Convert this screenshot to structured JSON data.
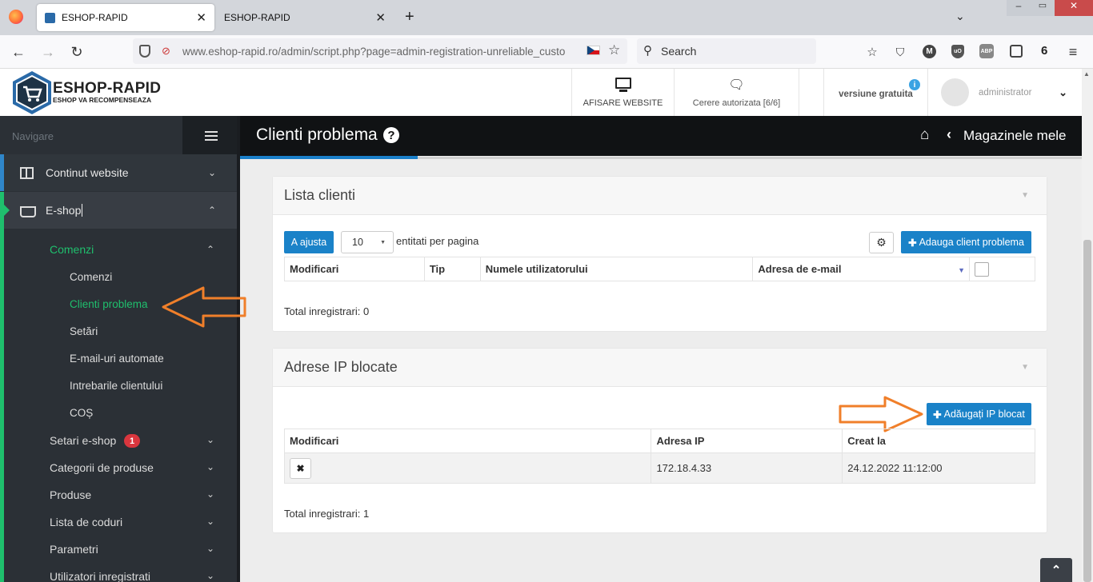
{
  "browser": {
    "tabs": [
      {
        "title": "ESHOP-RAPID",
        "active": true
      },
      {
        "title": "ESHOP-RAPID",
        "active": false
      }
    ],
    "url": "www.eshop-rapid.ro/admin/script.php?page=admin-registration-unreliable_custo",
    "search_placeholder": "Search",
    "badge_count": "6"
  },
  "header": {
    "logo_title": "ESHOP-RAPID",
    "logo_sub": "ESHOP VA RECOMPENSEAZA",
    "view_website": "AFISARE WEBSITE",
    "auth_request": "Cerere autorizata [6/6]",
    "version": "versiune gratuita",
    "user": "administrator"
  },
  "sidebar": {
    "nav_label": "Navigare",
    "items": {
      "website": "Continut website",
      "eshop": "E-shop",
      "comenzi": "Comenzi",
      "comenzi_sub": [
        "Comenzi",
        "Clienti problema",
        "Setări",
        "E-mail-uri automate",
        "Intrebarile clientului",
        "COȘ"
      ],
      "setari_eshop": "Setari e-shop",
      "setari_badge": "1",
      "categorii": "Categorii de produse",
      "produse": "Produse",
      "coduri": "Lista de coduri",
      "parametri": "Parametri",
      "utilizatori": "Utilizatori inregistrati"
    }
  },
  "main": {
    "title": "Clienti problema",
    "breadcrumb": "Magazinele mele",
    "panel1": {
      "title": "Lista clienti",
      "adjust_button": "A ajusta",
      "page_size": "10",
      "page_size_label": "entitati per pagina",
      "add_button": "Adauga client problema",
      "columns": [
        "Modificari",
        "Tip",
        "Numele utilizatorului",
        "Adresa de e-mail"
      ],
      "total": "Total inregistrari: 0"
    },
    "panel2": {
      "title": "Adrese IP blocate",
      "add_button": "Adăugați IP blocat",
      "columns": [
        "Modificari",
        "Adresa IP",
        "Creat la"
      ],
      "rows": [
        {
          "ip": "172.18.4.33",
          "created": "24.12.2022 11:12:00"
        }
      ],
      "total": "Total inregistrari: 1"
    }
  },
  "colors": {
    "accent": "#1a82c8",
    "active_green": "#1fbf6d",
    "annotation_orange": "#f07f2a",
    "badge_red": "#d9363e"
  }
}
